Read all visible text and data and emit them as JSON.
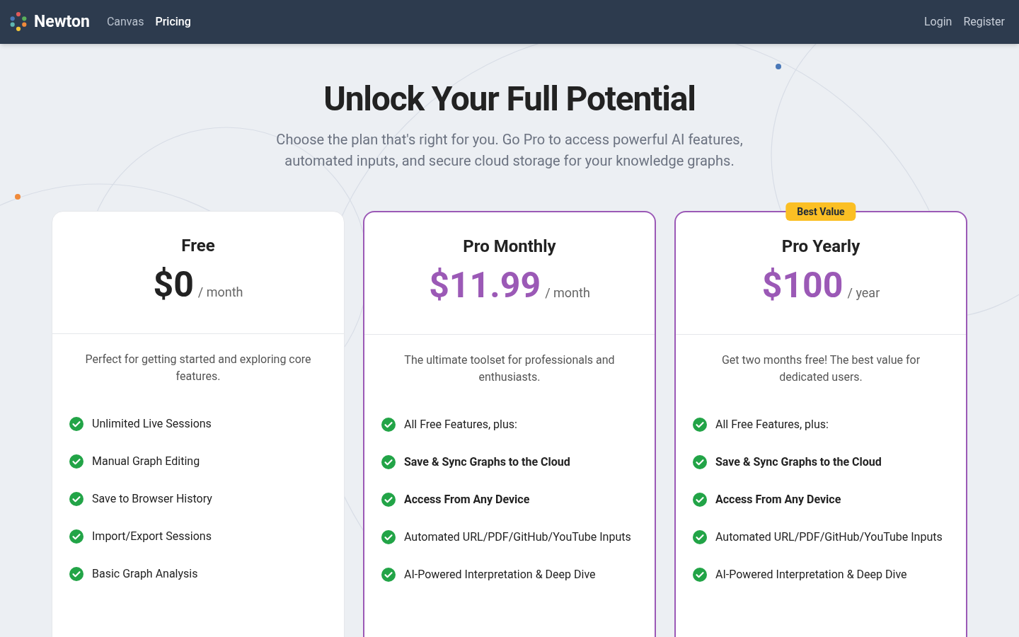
{
  "navbar": {
    "brand": "Newton",
    "links": [
      {
        "label": "Canvas",
        "selected": false
      },
      {
        "label": "Pricing",
        "selected": true
      }
    ],
    "auth_links": [
      "Login",
      "Register"
    ]
  },
  "hero": {
    "title": "Unlock Your Full Potential",
    "subtitle": "Choose the plan that's right for you. Go Pro to access powerful AI features, automated inputs, and secure cloud storage for your knowledge graphs."
  },
  "plans": [
    {
      "name": "Free",
      "price": "$0",
      "period": "/ month",
      "highlighted": false,
      "description": "Perfect for getting started and exploring core features.",
      "features": [
        {
          "text": "Unlimited Live Sessions",
          "emphasized": false
        },
        {
          "text": "Manual Graph Editing",
          "emphasized": false
        },
        {
          "text": "Save to Browser History",
          "emphasized": false
        },
        {
          "text": "Import/Export Sessions",
          "emphasized": false
        },
        {
          "text": "Basic Graph Analysis",
          "emphasized": false
        }
      ]
    },
    {
      "name": "Pro Monthly",
      "price": "$11.99",
      "period": "/ month",
      "highlighted": true,
      "description": "The ultimate toolset for professionals and enthusiasts.",
      "features": [
        {
          "text": "All Free Features, plus:",
          "emphasized": false
        },
        {
          "text": "Save & Sync Graphs to the Cloud",
          "emphasized": true
        },
        {
          "text": "Access From Any Device",
          "emphasized": true
        },
        {
          "text": "Automated URL/PDF/GitHub/YouTube Inputs",
          "emphasized": false
        },
        {
          "text": "AI-Powered Interpretation & Deep Dive",
          "emphasized": false
        }
      ]
    },
    {
      "name": "Pro Yearly",
      "price": "$100",
      "period": "/ year",
      "highlighted": true,
      "badge": "Best Value",
      "description": "Get two months free! The best value for dedicated users.",
      "features": [
        {
          "text": "All Free Features, plus:",
          "emphasized": false
        },
        {
          "text": "Save & Sync Graphs to the Cloud",
          "emphasized": true
        },
        {
          "text": "Access From Any Device",
          "emphasized": true
        },
        {
          "text": "Automated URL/PDF/GitHub/YouTube Inputs",
          "emphasized": false
        },
        {
          "text": "AI-Powered Interpretation & Deep Dive",
          "emphasized": false
        }
      ]
    }
  ]
}
